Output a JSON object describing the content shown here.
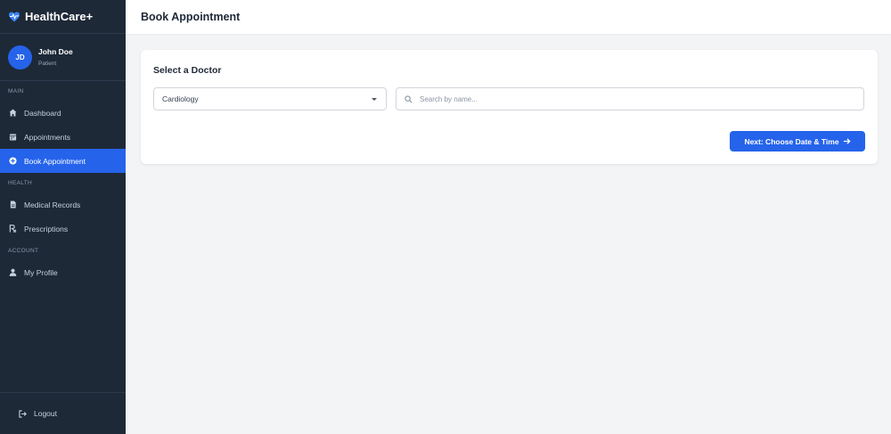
{
  "app": {
    "name": "HealthCare+"
  },
  "user": {
    "initials": "JD",
    "name": "John Doe",
    "role": "Patient"
  },
  "sidebar": {
    "sections": [
      {
        "label": "MAIN",
        "items": [
          {
            "label": "Dashboard",
            "icon": "home-icon"
          },
          {
            "label": "Appointments",
            "icon": "calendar-icon"
          },
          {
            "label": "Book Appointment",
            "icon": "plus-circle-icon",
            "active": true
          }
        ]
      },
      {
        "label": "HEALTH",
        "items": [
          {
            "label": "Medical Records",
            "icon": "file-icon"
          },
          {
            "label": "Prescriptions",
            "icon": "prescription-icon"
          }
        ]
      },
      {
        "label": "ACCOUNT",
        "items": [
          {
            "label": "My Profile",
            "icon": "user-icon"
          }
        ]
      }
    ],
    "logout": "Logout"
  },
  "header": {
    "title": "Book Appointment"
  },
  "card": {
    "title": "Select a Doctor",
    "specialty": {
      "selected": "Cardiology"
    },
    "search": {
      "placeholder": "Search by name...",
      "value": ""
    },
    "next_label": "Next: Choose Date & Time"
  },
  "colors": {
    "sidebar_bg": "#1e2938",
    "accent": "#2563eb",
    "page_bg": "#f3f4f6"
  }
}
